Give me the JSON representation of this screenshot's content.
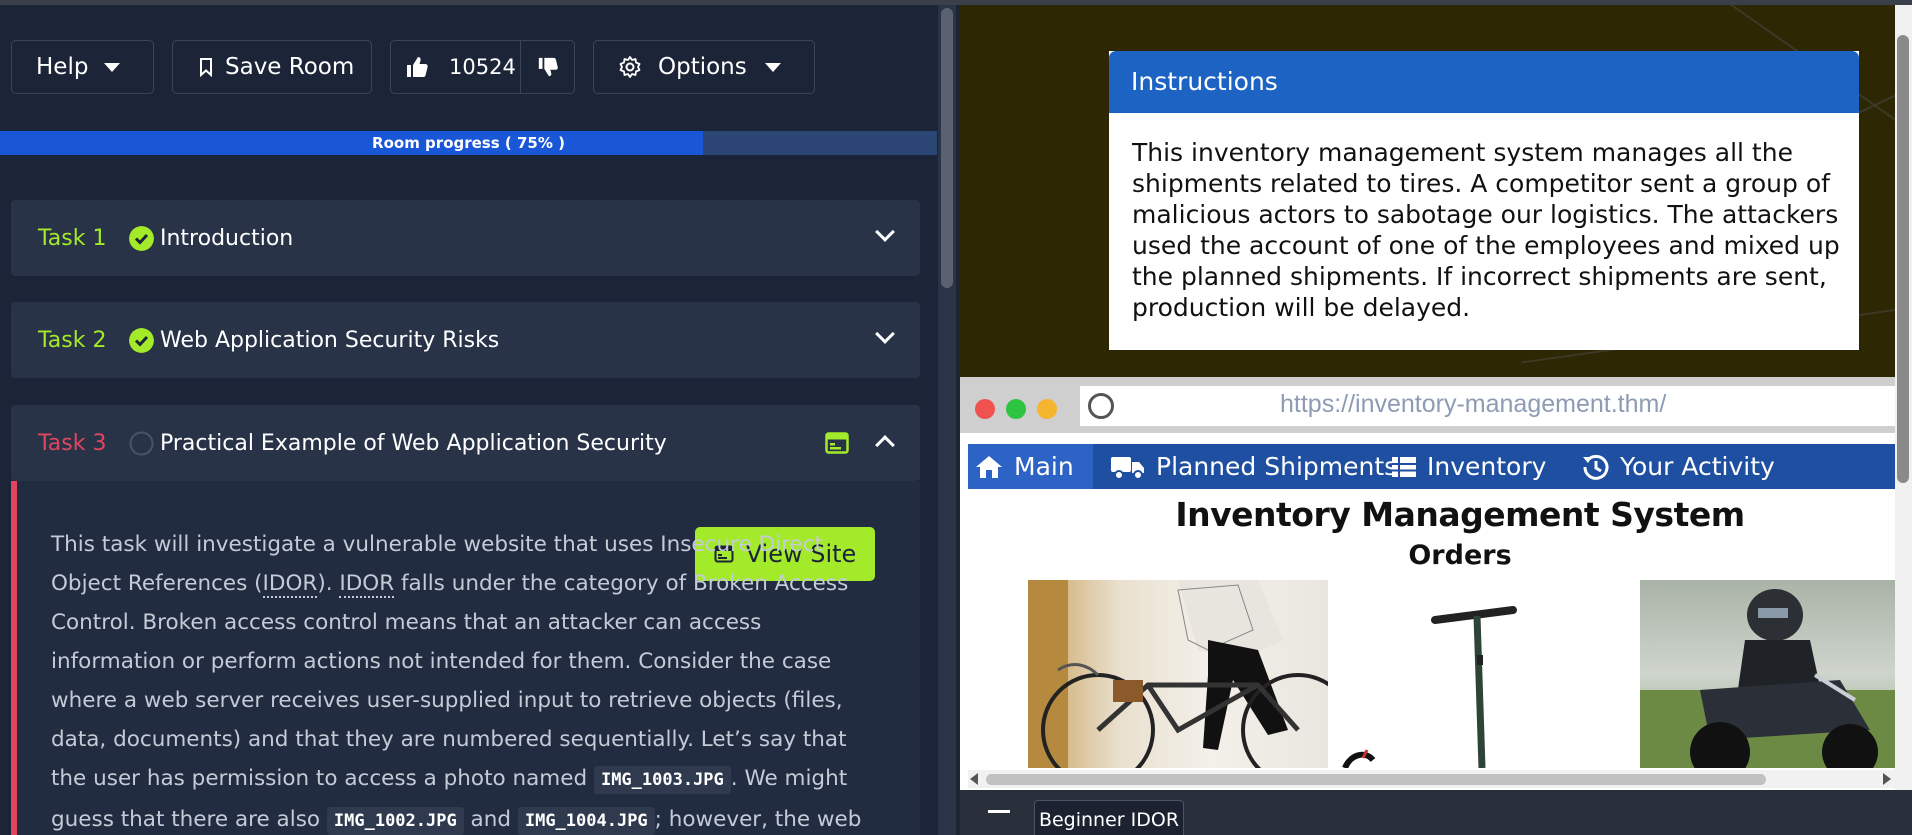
{
  "toolbar": {
    "help_label": "Help",
    "save_label": "Save Room",
    "like_count": "10524",
    "options_label": "Options"
  },
  "progress": {
    "label": "Room progress ( 75% )",
    "percent": 75
  },
  "tasks": [
    {
      "number": "Task 1",
      "title": "Introduction",
      "status": "complete",
      "color": "#a3ea2a"
    },
    {
      "number": "Task 2",
      "title": "Web Application Security Risks",
      "status": "complete",
      "color": "#a3ea2a"
    },
    {
      "number": "Task 3",
      "title": "Practical Example of Web Application Security",
      "status": "incomplete",
      "color": "#e0465d"
    }
  ],
  "task3": {
    "view_site_label": "View Site",
    "p1": "This task will investigate a vulnerable website that uses Insecure Direct Object References (",
    "abbr1": "IDOR",
    "p2": "). ",
    "abbr2": "IDOR",
    "p3": " falls under the category of Broken Access Control. Broken access control means that an attacker can access information or perform actions not intended for them. Consider the case where a web server receives user-supplied input to retrieve objects (files, data, documents) and that they are numbered sequentially. Let’s say that the user has permission to access a photo named ",
    "code1": "IMG_1003.JPG",
    "p4": ". We might guess that there are also ",
    "code2": "IMG_1002.JPG",
    "p5": " and ",
    "code3": "IMG_1004.JPG",
    "p6": "; however, the web"
  },
  "instructions": {
    "header": "Instructions",
    "body": "This inventory management system manages all the shipments related to tires. A competitor sent a group of malicious actors to sabotage our logistics. The attackers used the account of one of the employees and mixed up the planned shipments. If incorrect shipments are sent, production will be delayed."
  },
  "browser": {
    "url": "https://inventory-management.thm/",
    "nav": [
      "Main",
      "Planned Shipments",
      "Inventory",
      "Your Activity"
    ],
    "title": "Inventory Management System",
    "subtitle": "Orders"
  },
  "bottom": {
    "tab_label": "Beginner IDOR"
  },
  "colors": {
    "accent_green": "#a3ea2a",
    "task_red": "#e0465d",
    "progress_blue": "#1a57d6",
    "instructions_blue": "#1c63c3",
    "nav_blue": "#1e4fa0"
  }
}
